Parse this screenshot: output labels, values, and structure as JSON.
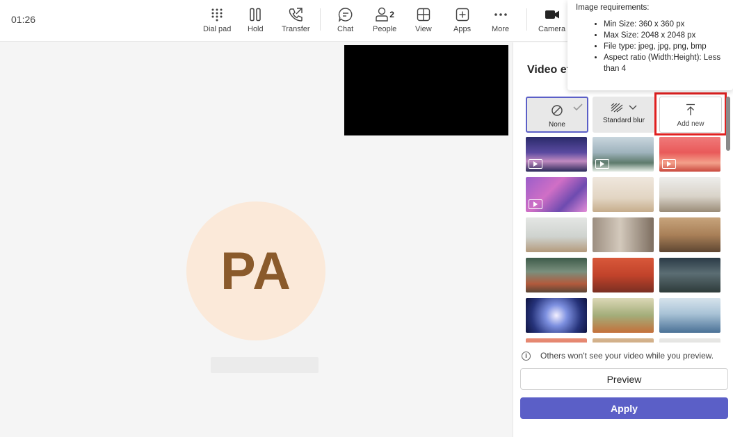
{
  "call": {
    "timer": "01:26",
    "toolbar": {
      "dialpad": "Dial pad",
      "hold": "Hold",
      "transfer": "Transfer",
      "chat": "Chat",
      "people": "People",
      "people_count": "2",
      "view": "View",
      "apps": "Apps",
      "more": "More",
      "camera": "Camera"
    },
    "participant_initials": "PA"
  },
  "panel": {
    "title": "Video effects",
    "options": {
      "none": "None",
      "blur": "Standard blur",
      "add_new": "Add new"
    },
    "backgrounds": [
      {
        "video": true
      },
      {
        "video": true
      },
      {
        "video": true
      },
      {
        "video": true
      },
      {
        "video": false
      },
      {
        "video": false
      },
      {
        "video": false
      },
      {
        "video": false
      },
      {
        "video": false
      },
      {
        "video": false
      },
      {
        "video": false
      },
      {
        "video": false
      },
      {
        "video": false
      },
      {
        "video": false
      },
      {
        "video": false
      },
      {
        "video": false
      },
      {
        "video": false
      },
      {
        "video": false
      }
    ],
    "info_text": "Others won't see your video while you preview.",
    "preview_label": "Preview",
    "apply_label": "Apply"
  },
  "tooltip": {
    "title": "Image requirements:",
    "items": [
      "Min Size: 360 x 360 px",
      "Max Size: 2048 x 2048 px",
      "File type: jpeg, jpg, png, bmp",
      "Aspect ratio (Width:Height): Less than 4"
    ]
  },
  "colors": {
    "accent": "#5b5fc7",
    "highlight": "#e02020",
    "avatar_bg": "#fbe9d9",
    "avatar_text": "#8a5a2b"
  }
}
